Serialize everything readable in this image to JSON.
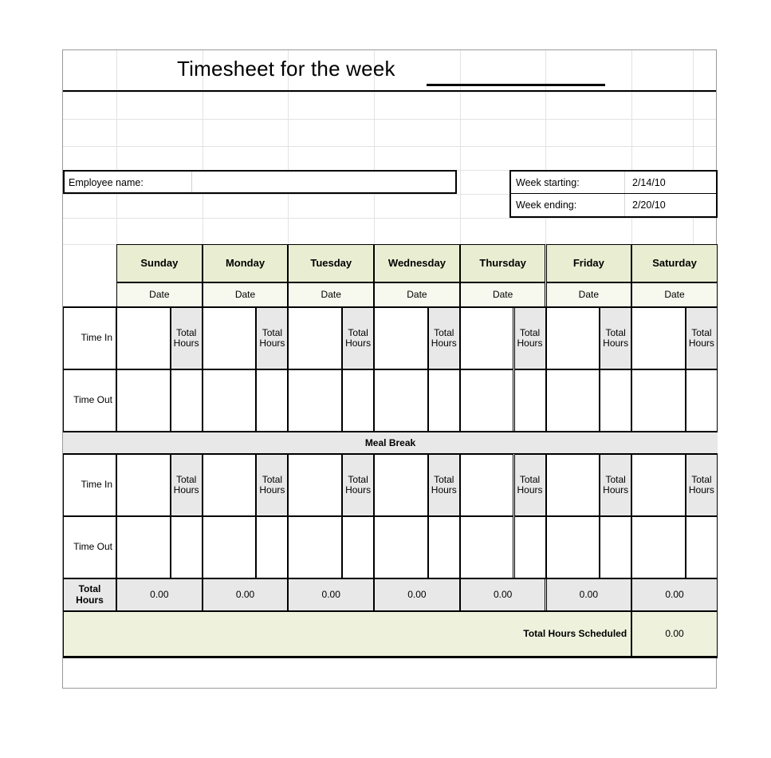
{
  "document": {
    "title": "Timesheet for the week",
    "title_blank": ""
  },
  "employee": {
    "label": "Employee name:",
    "value": ""
  },
  "week": {
    "starting_label": "Week starting:",
    "starting_value": "2/14/10",
    "ending_label": "Week ending:",
    "ending_value": "2/20/10"
  },
  "grid": {
    "days": [
      "Sunday",
      "Monday",
      "Tuesday",
      "Wednesday",
      "Thursday",
      "Friday",
      "Saturday"
    ],
    "date_label": "Date",
    "time_in_label": "Time In",
    "time_out_label": "Time Out",
    "total_hours_sub_label_line1": "Total",
    "total_hours_sub_label_line2": "Hours",
    "meal_break_label": "Meal Break",
    "total_hours_row_label": "Total Hours",
    "total_hours_values": [
      "0.00",
      "0.00",
      "0.00",
      "0.00",
      "0.00",
      "0.00",
      "0.00"
    ],
    "total_scheduled_label": "Total Hours Scheduled",
    "total_scheduled_value": "0.00"
  },
  "colors": {
    "day_header_bg": "#e9eed2",
    "date_row_bg": "#f7f8ee",
    "total_hours_bg": "#e8e8e8",
    "scheduled_bg": "#eef1dc",
    "border": "#000000"
  }
}
